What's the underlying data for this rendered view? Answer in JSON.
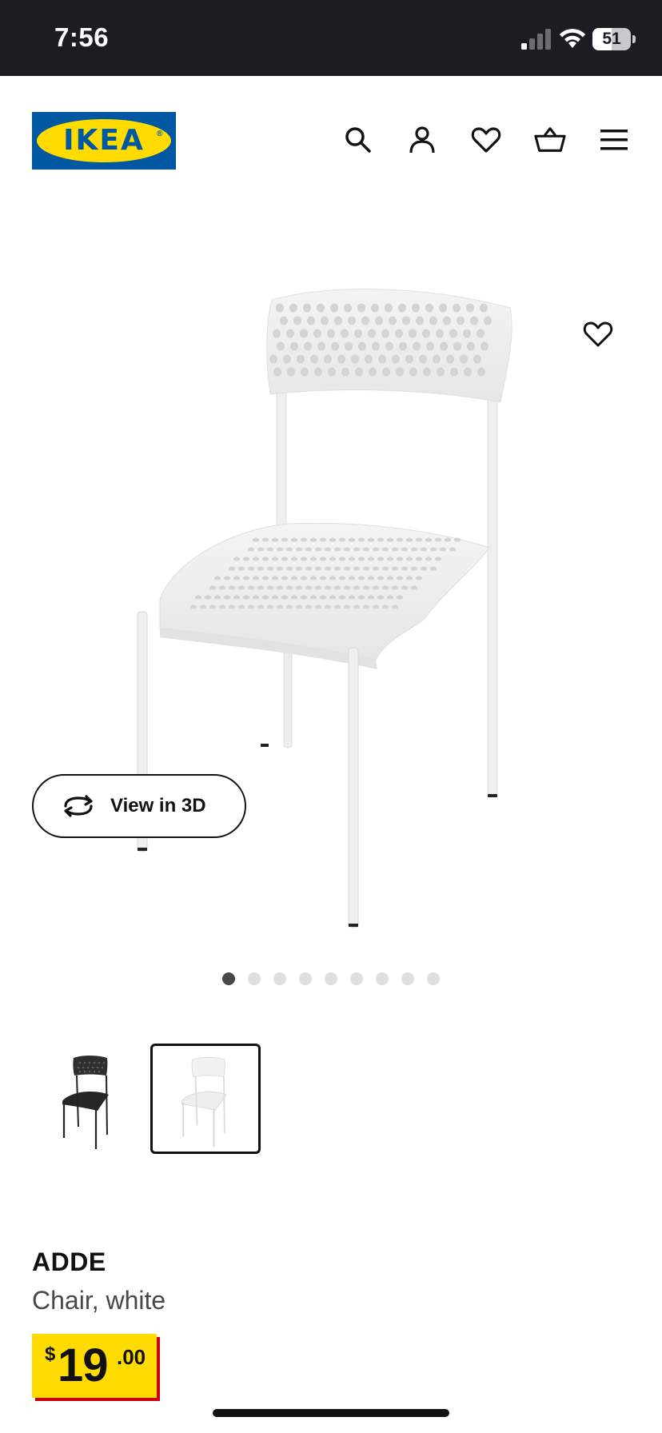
{
  "status_bar": {
    "time": "7:56",
    "battery_level": "51",
    "battery_fraction": 0.51,
    "signal_bars_active": 1
  },
  "header": {
    "logo_text": "IKEA",
    "logo_colors": {
      "blue": "#0058a3",
      "yellow": "#ffdb00"
    },
    "icons": [
      "search-icon",
      "account-icon",
      "favorites-heart-icon",
      "shopping-basket-icon",
      "hamburger-menu-icon"
    ]
  },
  "gallery": {
    "view_3d_label": "View in 3D",
    "total_images": 9,
    "active_image_index": 0,
    "image_subject": "white chair",
    "thumbnails": [
      {
        "variant": "black",
        "selected": false
      },
      {
        "variant": "white",
        "selected": true
      }
    ]
  },
  "product": {
    "name": "ADDE",
    "description": "Chair, white",
    "price": {
      "currency": "$",
      "integer": "19",
      "decimal": ".00"
    },
    "price_tag_colors": {
      "background": "#ffdb00",
      "shadow": "#cc0008"
    }
  }
}
